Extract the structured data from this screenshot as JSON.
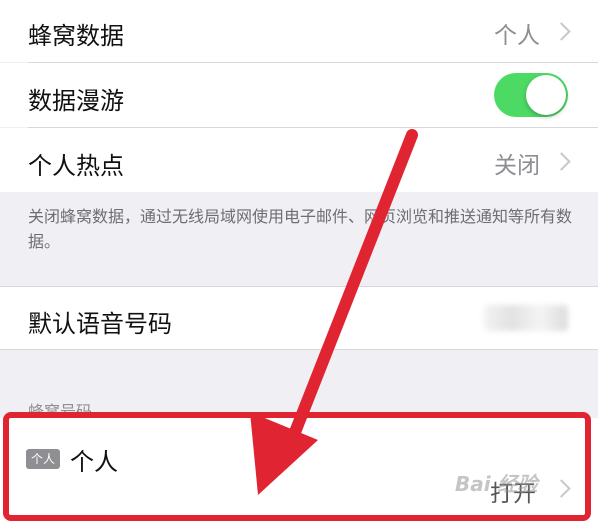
{
  "rows": {
    "cellular": {
      "label": "蜂窝数据",
      "value": "个人"
    },
    "roaming": {
      "label": "数据漫游",
      "toggle_on": true
    },
    "hotspot": {
      "label": "个人热点",
      "value": "关闭"
    },
    "voice": {
      "label": "默认语音号码"
    },
    "personal": {
      "badge": "个人",
      "label": "个人",
      "value": "打开"
    }
  },
  "footnote": "关闭蜂窝数据，通过无线局域网使用电子邮件、网页浏览和推送通知等所有数据。",
  "section_header": "蜂窝号码",
  "watermark": "Bai 经验",
  "colors": {
    "toggle_green": "#4cd964",
    "annotation_red": "#e02432",
    "background": "#efeff4"
  }
}
